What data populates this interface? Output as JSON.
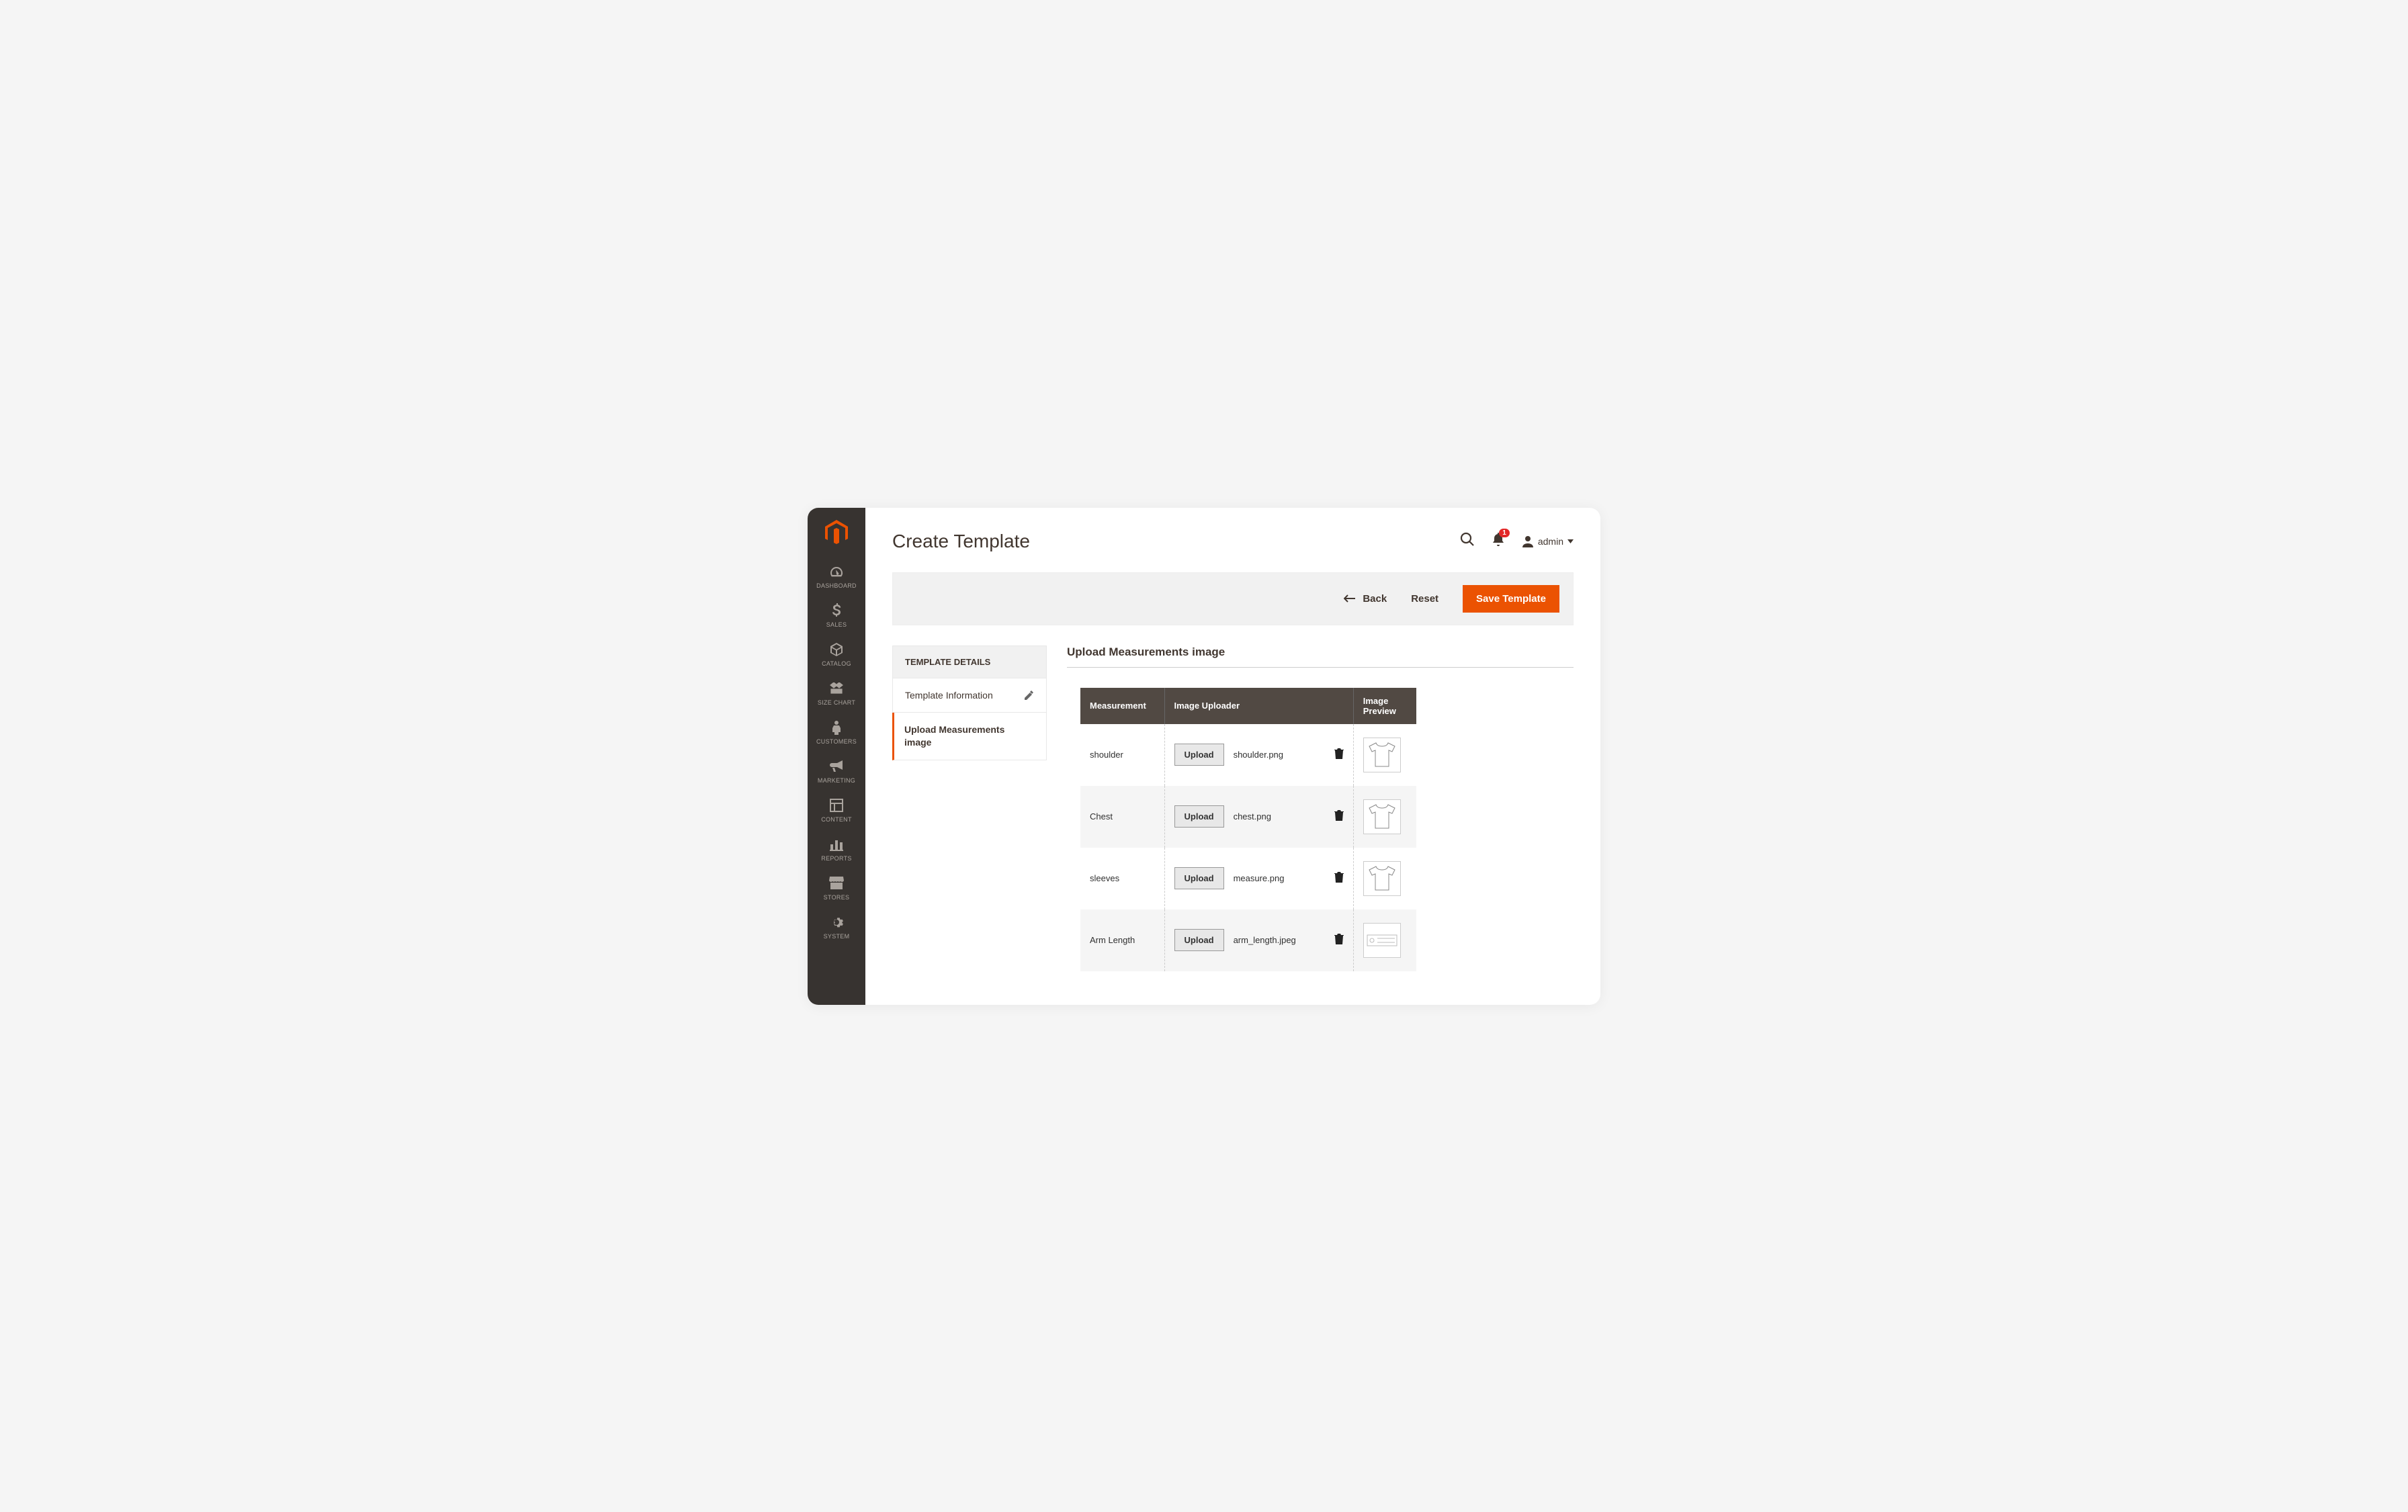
{
  "sidebar": {
    "items": [
      {
        "label": "DASHBOARD",
        "icon": "gauge"
      },
      {
        "label": "SALES",
        "icon": "dollar"
      },
      {
        "label": "CATALOG",
        "icon": "cube"
      },
      {
        "label": "SIZE CHART",
        "icon": "ruler"
      },
      {
        "label": "CUSTOMERS",
        "icon": "person"
      },
      {
        "label": "MARKETING",
        "icon": "megaphone"
      },
      {
        "label": "CONTENT",
        "icon": "layout"
      },
      {
        "label": "REPORTS",
        "icon": "bars"
      },
      {
        "label": "STORES",
        "icon": "storefront"
      },
      {
        "label": "SYSTEM",
        "icon": "gear"
      }
    ]
  },
  "header": {
    "page_title": "Create Template",
    "notification_count": "1",
    "user_name": "admin"
  },
  "actions": {
    "back_label": "Back",
    "reset_label": "Reset",
    "save_label": "Save Template"
  },
  "side_panel": {
    "header": "TEMPLATE DETAILS",
    "items": [
      {
        "label": "Template Information",
        "active": false,
        "has_edit_icon": true
      },
      {
        "label": "Upload Measurements image",
        "active": true,
        "has_edit_icon": false
      }
    ]
  },
  "section": {
    "title": "Upload Measurements image"
  },
  "table": {
    "columns": [
      "Measurement",
      "Image Uploader",
      "Image Preview"
    ],
    "upload_button_label": "Upload",
    "rows": [
      {
        "measurement": "shoulder",
        "filename": "shoulder.png",
        "preview": "tshirt"
      },
      {
        "measurement": "Chest",
        "filename": "chest.png",
        "preview": "tshirt"
      },
      {
        "measurement": "sleeves",
        "filename": "measure.png",
        "preview": "tshirt-plain"
      },
      {
        "measurement": "Arm Length",
        "filename": "arm_length.jpeg",
        "preview": "tape"
      }
    ]
  }
}
